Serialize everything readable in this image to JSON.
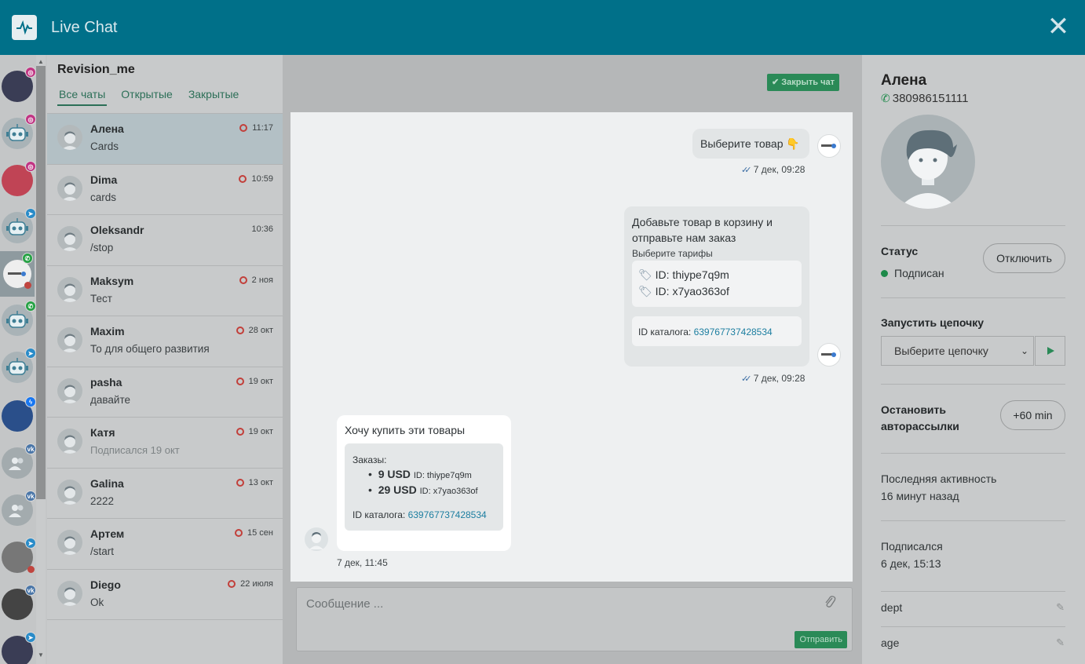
{
  "header": {
    "title": "Live Chat",
    "close_label": "✕"
  },
  "sidebar": {
    "channels": [
      {
        "type": "instagram",
        "badge": "◎",
        "badge_color": "#c13584",
        "avatar": "photo"
      },
      {
        "type": "instagram",
        "badge": "◎",
        "badge_color": "#c13584",
        "avatar": "bot"
      },
      {
        "type": "instagram",
        "badge": "◎",
        "badge_color": "#c13584",
        "avatar": "photo"
      },
      {
        "type": "telegram",
        "badge": "➤",
        "badge_color": "#2a8cc9",
        "avatar": "bot"
      },
      {
        "type": "whatsapp",
        "badge": "✆",
        "badge_color": "#25a244",
        "avatar": "brand"
      },
      {
        "type": "whatsapp",
        "badge": "✆",
        "badge_color": "#25a244",
        "avatar": "bot"
      },
      {
        "type": "telegram",
        "badge": "➤",
        "badge_color": "#2a8cc9",
        "avatar": "bot"
      },
      {
        "type": "messenger",
        "badge": "ϟ",
        "badge_color": "#1877f2",
        "avatar": "photo"
      },
      {
        "type": "vk",
        "badge": "vk",
        "badge_color": "#4a76a8",
        "avatar": "group"
      },
      {
        "type": "vk",
        "badge": "vk",
        "badge_color": "#4a76a8",
        "avatar": "group"
      },
      {
        "type": "telegram",
        "badge": "➤",
        "badge_color": "#2a8cc9",
        "avatar": "photo"
      },
      {
        "type": "vk",
        "badge": "vk",
        "badge_color": "#4a76a8",
        "avatar": "photo"
      },
      {
        "type": "telegram",
        "badge": "➤",
        "badge_color": "#2a8cc9",
        "avatar": "photo"
      }
    ]
  },
  "chatlist": {
    "account": "Revision_me",
    "tabs": [
      "Все чаты",
      "Открытые",
      "Закрытые"
    ],
    "chats": [
      {
        "name": "Алена",
        "msg": "Cards",
        "time": "11:17",
        "unread": true
      },
      {
        "name": "Dima",
        "msg": "cards",
        "time": "10:59",
        "unread": true
      },
      {
        "name": "Oleksandr",
        "msg": "/stop",
        "time": "10:36",
        "unread": false
      },
      {
        "name": "Maksym",
        "msg": "Тест",
        "time": "2 ноя",
        "unread": true
      },
      {
        "name": "Maxim",
        "msg": "То для общего развития",
        "time": "28 окт",
        "unread": true
      },
      {
        "name": "pasha",
        "msg": "давайте",
        "time": "19 окт",
        "unread": true
      },
      {
        "name": "Катя",
        "msg": "Подписался 19 окт",
        "time": "19 окт",
        "unread": true
      },
      {
        "name": "Galina",
        "msg": "2222",
        "time": "13 окт",
        "unread": true
      },
      {
        "name": "Артем",
        "msg": "/start",
        "time": "15 сен",
        "unread": true
      },
      {
        "name": "Diego",
        "msg": "Ok",
        "time": "22 июля",
        "unread": true
      }
    ]
  },
  "conversation": {
    "close_chat": "✔ Закрыть чат",
    "msg1": {
      "text": "Выберите товар 👇",
      "time": "7 дек, 09:28"
    },
    "msg2": {
      "title_line1": "Добавьте товар в корзину и",
      "title_line2": "отправьте нам заказ",
      "subtitle": "Выберите тарифы",
      "ids": [
        "ID: thiype7q9m",
        "ID: x7yao363of"
      ],
      "catalog_label": "ID каталога:",
      "catalog_id": "639767737428534",
      "time": "7 дек, 09:28"
    },
    "msg3": {
      "text": "Хочу купить эти товары",
      "orders_label": "Заказы:",
      "items": [
        {
          "price": "9 USD",
          "id": "ID: thiype7q9m"
        },
        {
          "price": "29 USD",
          "id": "ID: x7yao363of"
        }
      ],
      "catalog_label": "ID каталога:",
      "catalog_id": "639767737428534",
      "time": "7 дек, 11:45"
    },
    "composer_placeholder": "Сообщение ...",
    "send_label": "Отправить"
  },
  "profile": {
    "name": "Алена",
    "phone": "380986151111",
    "status_label": "Статус",
    "status_value": "Подписан",
    "unsubscribe_label": "Отключить",
    "chain_label": "Запустить цепочку",
    "chain_select": "Выберите цепочку",
    "stop_label_1": "Остановить",
    "stop_label_2": "авторассылки",
    "stop_button": "+60 min",
    "last_activity_label": "Последняя активность",
    "last_activity_value": "16 минут назад",
    "subscribed_label": "Подписался",
    "subscribed_value": "6 дек, 15:13",
    "fields": [
      "dept",
      "age"
    ]
  },
  "colors": {
    "header": "#007089",
    "accent_green": "#2a8a57",
    "link": "#1c7ea0",
    "unread": "#c23f3a"
  }
}
